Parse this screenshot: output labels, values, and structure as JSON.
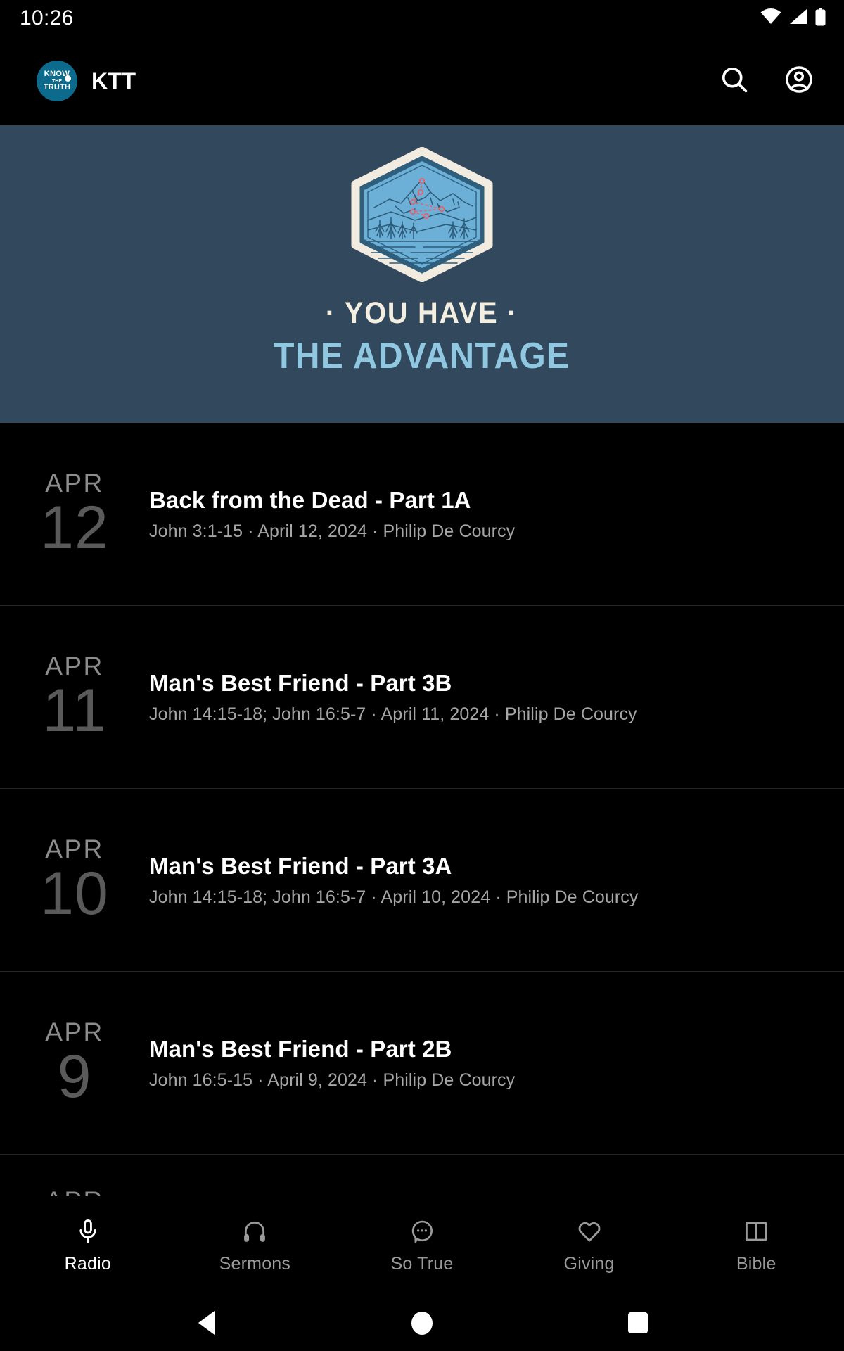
{
  "status_bar": {
    "clock": "10:26",
    "icons": [
      "wifi-icon",
      "cellular-signal-icon",
      "battery-icon"
    ]
  },
  "app_bar": {
    "logo": {
      "name": "know-the-truth-logo",
      "line1": "KNOW",
      "line2": "THE",
      "line3": "TRUTH",
      "color": "#0c6a8c"
    },
    "title": "KTT",
    "actions": [
      {
        "name": "search-icon",
        "label": "Search"
      },
      {
        "name": "account-circle-icon",
        "label": "Account"
      }
    ]
  },
  "banner": {
    "name": "you-have-the-advantage-banner",
    "line1": "· YOU HAVE ·",
    "line2": "THE ADVANTAGE",
    "background_color": "#32495d",
    "line1_color": "#f5efe2",
    "line2_color": "#8fc8e0",
    "badge_fill": "#6cb0d8",
    "badge_outline": "#f2ece0",
    "trail_color": "#e8606b"
  },
  "sermons": [
    {
      "month": "APR",
      "day": "12",
      "title": "Back from the Dead - Part 1A",
      "meta": "John 3:1-15 · April 12, 2024 · Philip De Courcy"
    },
    {
      "month": "APR",
      "day": "11",
      "title": "Man's Best Friend - Part 3B",
      "meta": "John 14:15-18; John 16:5-7 · April 11, 2024 · Philip De Courcy"
    },
    {
      "month": "APR",
      "day": "10",
      "title": "Man's Best Friend - Part 3A",
      "meta": "John 14:15-18; John 16:5-7 · April 10, 2024 · Philip De Courcy"
    },
    {
      "month": "APR",
      "day": "9",
      "title": "Man's Best Friend - Part 2B",
      "meta": "John 16:5-15 · April 9, 2024 · Philip De Courcy"
    },
    {
      "month": "APR",
      "day": "",
      "title": "",
      "meta": ""
    }
  ],
  "bottom_nav": {
    "active_index": 0,
    "items": [
      {
        "label": "Radio",
        "icon": "microphone-icon"
      },
      {
        "label": "Sermons",
        "icon": "headphones-icon"
      },
      {
        "label": "So True",
        "icon": "chat-bubble-dots-icon"
      },
      {
        "label": "Giving",
        "icon": "heart-outline-icon"
      },
      {
        "label": "Bible",
        "icon": "open-book-icon"
      }
    ]
  },
  "system_nav": {
    "back": "back-triangle-icon",
    "home": "home-circle-icon",
    "recents": "recents-square-icon"
  }
}
